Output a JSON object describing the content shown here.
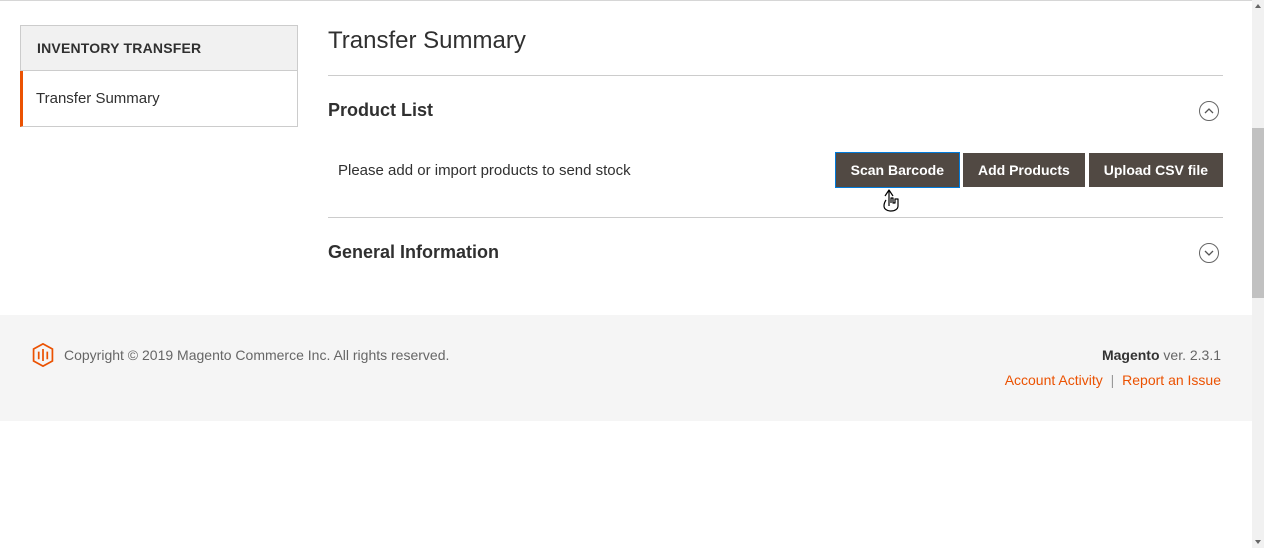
{
  "sidebar": {
    "header": "INVENTORY TRANSFER",
    "items": [
      {
        "label": "Transfer Summary"
      }
    ]
  },
  "main": {
    "title": "Transfer Summary",
    "sections": {
      "product_list": {
        "title": "Product List",
        "hint": "Please add or import products to send stock",
        "buttons": {
          "scan": "Scan Barcode",
          "add": "Add Products",
          "upload": "Upload CSV file"
        }
      },
      "general_info": {
        "title": "General Information"
      }
    }
  },
  "footer": {
    "copyright": "Copyright © 2019 Magento Commerce Inc. All rights reserved.",
    "brand": "Magento",
    "version": " ver. 2.3.1",
    "links": {
      "account_activity": "Account Activity",
      "report_issue": "Report an Issue"
    }
  }
}
